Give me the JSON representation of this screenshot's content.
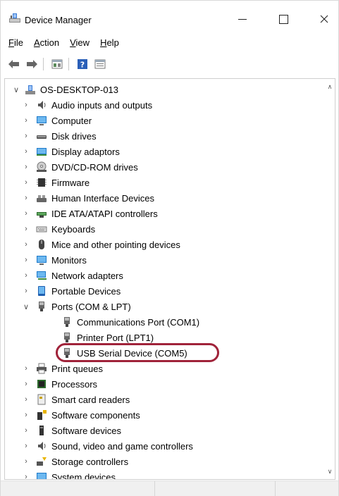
{
  "window": {
    "title": "Device Manager",
    "icon": "device-manager-icon"
  },
  "menu": [
    {
      "accel": "F",
      "rest": "ile"
    },
    {
      "accel": "A",
      "rest": "ction"
    },
    {
      "accel": "V",
      "rest": "iew"
    },
    {
      "accel": "H",
      "rest": "elp"
    }
  ],
  "toolbar": {
    "icons": [
      "back-arrow-icon",
      "forward-arrow-icon",
      "properties-icon",
      "help-icon",
      "view-icon"
    ]
  },
  "tree": {
    "root": "OS-DESKTOP-013",
    "categories": [
      {
        "label": "Audio inputs and outputs",
        "icon": "speaker-icon",
        "expanded": false
      },
      {
        "label": "Computer",
        "icon": "monitor-icon",
        "expanded": false
      },
      {
        "label": "Disk drives",
        "icon": "disk-icon",
        "expanded": false
      },
      {
        "label": "Display adaptors",
        "icon": "display-adapter-icon",
        "expanded": false
      },
      {
        "label": "DVD/CD-ROM drives",
        "icon": "dvd-icon",
        "expanded": false
      },
      {
        "label": "Firmware",
        "icon": "chip-icon",
        "expanded": false
      },
      {
        "label": "Human Interface Devices",
        "icon": "hid-icon",
        "expanded": false
      },
      {
        "label": "IDE ATA/ATAPI controllers",
        "icon": "ide-icon",
        "expanded": false
      },
      {
        "label": "Keyboards",
        "icon": "keyboard-icon",
        "expanded": false
      },
      {
        "label": "Mice and other pointing devices",
        "icon": "mouse-icon",
        "expanded": false
      },
      {
        "label": "Monitors",
        "icon": "monitor-icon",
        "expanded": false
      },
      {
        "label": "Network adapters",
        "icon": "network-icon",
        "expanded": false
      },
      {
        "label": "Portable Devices",
        "icon": "portable-device-icon",
        "expanded": false
      },
      {
        "label": "Ports (COM & LPT)",
        "icon": "port-icon",
        "expanded": true
      }
    ],
    "ports_children": [
      {
        "label": "Communications Port (COM1)",
        "icon": "port-icon"
      },
      {
        "label": "Printer Port (LPT1)",
        "icon": "port-icon"
      },
      {
        "label": "USB Serial Device (COM5)",
        "icon": "port-icon",
        "highlighted": true
      }
    ],
    "categories_after": [
      {
        "label": "Print queues",
        "icon": "printer-icon"
      },
      {
        "label": "Processors",
        "icon": "processor-icon"
      },
      {
        "label": "Smart card readers",
        "icon": "smart-card-icon"
      },
      {
        "label": "Software components",
        "icon": "software-component-icon"
      },
      {
        "label": "Software devices",
        "icon": "software-device-icon"
      },
      {
        "label": "Sound, video and game controllers",
        "icon": "speaker-icon"
      },
      {
        "label": "Storage controllers",
        "icon": "storage-icon"
      },
      {
        "label": "System devices",
        "icon": "system-device-icon"
      }
    ]
  },
  "colors": {
    "highlight_ring": "#a0233a",
    "accent": "#0078d7"
  }
}
